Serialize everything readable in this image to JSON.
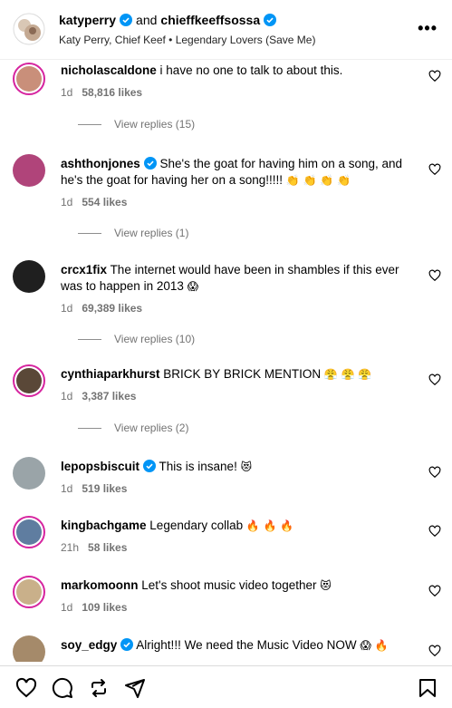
{
  "header": {
    "owner1": "katyperry",
    "and_text": "and",
    "owner2": "chieffkeeffsossa",
    "subtitle": "Katy Perry, Chief Keef • Legendary Lovers (Save Me)",
    "more_icon": "more-horizontal-icon"
  },
  "comments": [
    {
      "user": "nicholascaldone",
      "verified": false,
      "text": "i have no one to talk to about this.",
      "emoji": "",
      "time": "1d",
      "likes": "58,816 likes",
      "replies": "View replies (15)"
    },
    {
      "user": "ashthonjones",
      "verified": true,
      "text": "She's the goat for having him on a song, and he's the goat for having her on a song!!!!!",
      "emoji": "👏 👏 👏 👏",
      "time": "1d",
      "likes": "554 likes",
      "replies": "View replies (1)"
    },
    {
      "user": "crcx1fix",
      "verified": false,
      "text": "The internet would have been in shambles if this ever was to happen in 2013",
      "emoji": "😱",
      "time": "1d",
      "likes": "69,389 likes",
      "replies": "View replies (10)"
    },
    {
      "user": "cynthiaparkhurst",
      "verified": false,
      "text": "BRICK BY BRICK MENTION",
      "emoji": "😤 😤 😤",
      "time": "1d",
      "likes": "3,387 likes",
      "replies": "View replies (2)"
    },
    {
      "user": "lepopsbiscuit",
      "verified": true,
      "text": "This is insane!",
      "emoji": "😻",
      "time": "1d",
      "likes": "519 likes",
      "replies": ""
    },
    {
      "user": "kingbachgame",
      "verified": false,
      "text": "Legendary collab",
      "emoji": "🔥 🔥 🔥",
      "time": "21h",
      "likes": "58 likes",
      "replies": ""
    },
    {
      "user": "markomoonn",
      "verified": false,
      "text": "Let's shoot music video together",
      "emoji": "😻",
      "time": "1d",
      "likes": "109 likes",
      "replies": ""
    },
    {
      "user": "soy_edgy",
      "verified": true,
      "text": "Alright!!! We need the Music Video NOW",
      "emoji": "😱 🔥",
      "time": "",
      "likes": "",
      "replies": ""
    }
  ],
  "icons": {
    "like": "heart-icon",
    "comment": "comment-icon",
    "repost": "repost-icon",
    "share": "send-icon",
    "save": "bookmark-icon"
  },
  "colors": {
    "verified": "#0095f6",
    "story_ring": "#d6249f",
    "meta_text": "#737373"
  }
}
